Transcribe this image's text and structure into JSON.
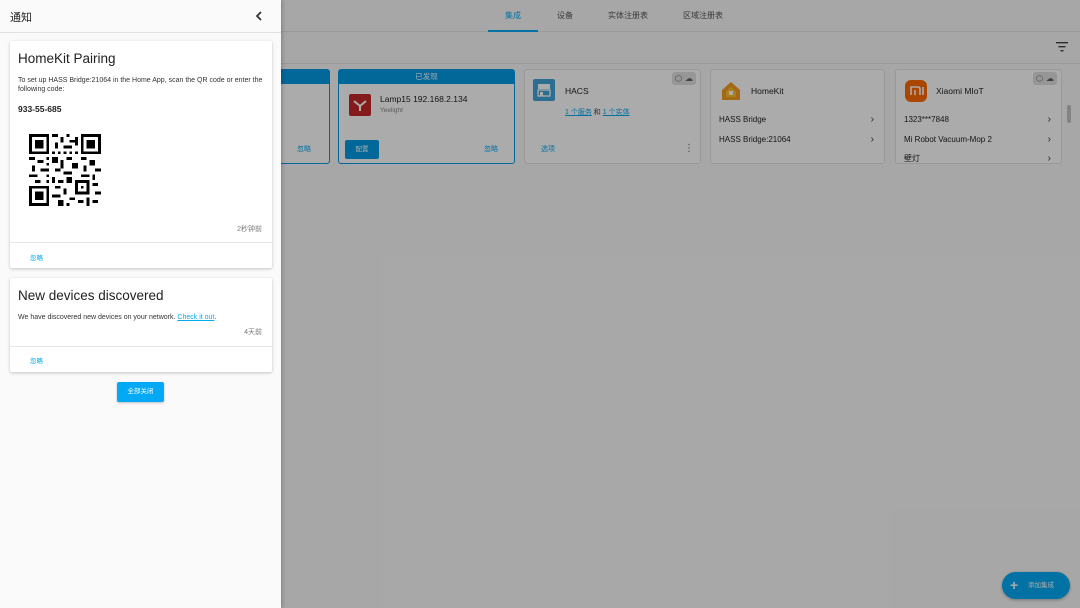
{
  "colors": {
    "accent": "#03a9f4",
    "banner": "#039be5",
    "yeelight": "#c62828",
    "homekit": "#f59d1f",
    "xiaomi": "#ff6900"
  },
  "topbar": {
    "tabs": [
      {
        "label": "集成",
        "active": true
      },
      {
        "label": "设备",
        "active": false
      },
      {
        "label": "实体注册表",
        "active": false
      },
      {
        "label": "区域注册表",
        "active": false
      }
    ],
    "filter_icon": "filter-icon"
  },
  "cards": {
    "partial": {
      "dismiss_label": "忽略"
    },
    "lamp": {
      "banner": "已发现",
      "title": "Lamp15 192.168.2.134",
      "subtitle": "Yeelight",
      "configure_label": "配置",
      "dismiss_label": "忽略",
      "icon": "yeelight-icon"
    },
    "hacs": {
      "title": "HACS",
      "services_link": "1 个服务",
      "and": "和",
      "entities_link": "1 个实体",
      "options_label": "选项",
      "icon": "hacs-icon",
      "badges": [
        "custom-component-icon",
        "cloud-icon"
      ]
    },
    "homekit": {
      "title": "HomeKit",
      "icon": "homekit-icon",
      "entries": [
        "HASS Bridge",
        "HASS Bridge:21064"
      ]
    },
    "xiaomi": {
      "title": "Xiaomi MIoT",
      "icon": "xiaomi-icon",
      "badges": [
        "custom-component-icon",
        "cloud-icon"
      ],
      "entries": [
        "1323***7848",
        "Mi Robot Vacuum-Mop 2",
        "壁灯"
      ]
    }
  },
  "fab": {
    "label": "添加集成"
  },
  "drawer": {
    "title": "通知",
    "notifications": [
      {
        "title": "HomeKit Pairing",
        "body": "To set up HASS Bridge:21064 in the Home App, scan the QR code or enter the following code:",
        "code": "933-55-685",
        "time": "2秒钟前",
        "dismiss_label": "忽略"
      },
      {
        "title": "New devices discovered",
        "body": "We have discovered new devices on your network.",
        "link": "Check it out",
        "link_suffix": ".",
        "time": "4天前",
        "dismiss_label": "忽略"
      }
    ],
    "dismiss_all_label": "全部关闭"
  }
}
